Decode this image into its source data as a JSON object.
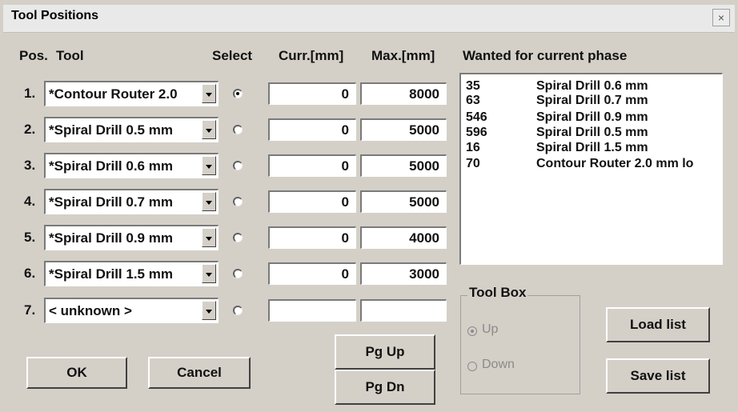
{
  "window": {
    "title": "Tool Positions",
    "close_glyph": "×"
  },
  "headers": {
    "pos": "Pos.",
    "tool": "Tool",
    "select": "Select",
    "curr": "Curr.[mm]",
    "max": "Max.[mm]",
    "wanted": "Wanted for current phase"
  },
  "rows": [
    {
      "num": "1.",
      "tool": "*Contour Router 2.0",
      "curr": "0",
      "max": "8000",
      "selected": true
    },
    {
      "num": "2.",
      "tool": "*Spiral Drill 0.5 mm",
      "curr": "0",
      "max": "5000",
      "selected": false
    },
    {
      "num": "3.",
      "tool": "*Spiral Drill 0.6 mm",
      "curr": "0",
      "max": "5000",
      "selected": false
    },
    {
      "num": "4.",
      "tool": "*Spiral Drill 0.7 mm",
      "curr": "0",
      "max": "5000",
      "selected": false
    },
    {
      "num": "5.",
      "tool": "*Spiral Drill 0.9 mm",
      "curr": "0",
      "max": "4000",
      "selected": false
    },
    {
      "num": "6.",
      "tool": "*Spiral Drill 1.5 mm",
      "curr": "0",
      "max": "3000",
      "selected": false
    },
    {
      "num": "7.",
      "tool": "< unknown >",
      "curr": "",
      "max": "",
      "selected": false
    }
  ],
  "wanted_list": [
    {
      "qty": "35",
      "name": "Spiral Drill 0.6 mm"
    },
    {
      "qty": "63",
      "name": "Spiral Drill 0.7 mm"
    },
    {
      "qty": "546",
      "name": "Spiral Drill 0.9 mm"
    },
    {
      "qty": "596",
      "name": "Spiral Drill 0.5 mm"
    },
    {
      "qty": "16",
      "name": "Spiral Drill 1.5 mm"
    },
    {
      "qty": "70",
      "name": "Contour Router 2.0 mm lo"
    }
  ],
  "toolbox": {
    "legend": "Tool Box",
    "up": "Up",
    "down": "Down",
    "selected": "up"
  },
  "buttons": {
    "ok": "OK",
    "cancel": "Cancel",
    "pg_up": "Pg Up",
    "pg_dn": "Pg Dn",
    "load_list": "Load list",
    "save_list": "Save list"
  }
}
